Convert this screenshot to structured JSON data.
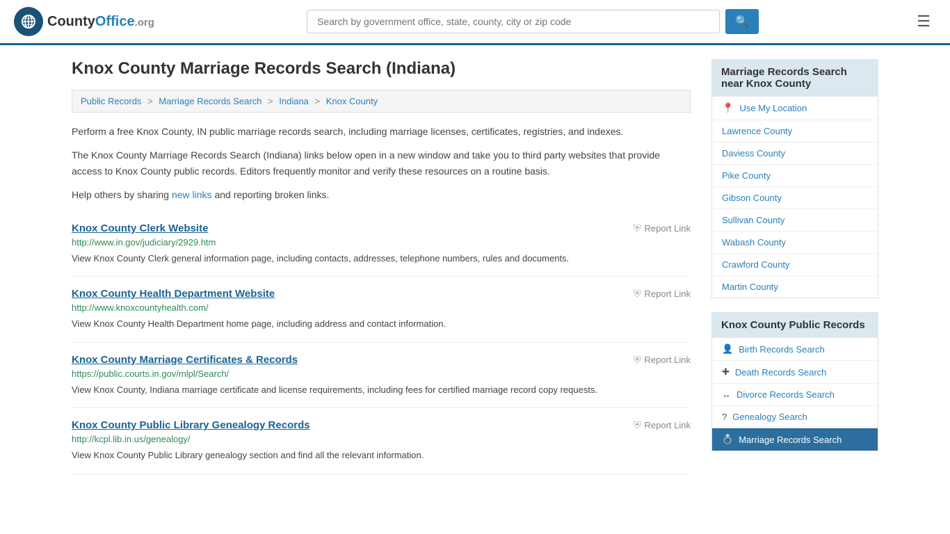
{
  "header": {
    "logo_text": "County",
    "logo_org": "Office.org",
    "search_placeholder": "Search by government office, state, county, city or zip code",
    "search_value": ""
  },
  "page": {
    "title": "Knox County Marriage Records Search (Indiana)",
    "breadcrumb": [
      {
        "label": "Public Records",
        "href": "#"
      },
      {
        "label": "Marriage Records Search",
        "href": "#"
      },
      {
        "label": "Indiana",
        "href": "#"
      },
      {
        "label": "Knox County",
        "href": "#"
      }
    ],
    "description1": "Perform a free Knox County, IN public marriage records search, including marriage licenses, certificates, registries, and indexes.",
    "description2": "The Knox County Marriage Records Search (Indiana) links below open in a new window and take you to third party websites that provide access to Knox County public records. Editors frequently monitor and verify these resources on a routine basis.",
    "description3_pre": "Help others by sharing ",
    "description3_link": "new links",
    "description3_post": " and reporting broken links.",
    "results": [
      {
        "title": "Knox County Clerk Website",
        "url": "http://www.in.gov/judiciary/2929.htm",
        "desc": "View Knox County Clerk general information page, including contacts, addresses, telephone numbers, rules and documents.",
        "report": "Report Link"
      },
      {
        "title": "Knox County Health Department Website",
        "url": "http://www.knoxcountyhealth.com/",
        "desc": "View Knox County Health Department home page, including address and contact information.",
        "report": "Report Link"
      },
      {
        "title": "Knox County Marriage Certificates & Records",
        "url": "https://public.courts.in.gov/mlpl/Search/",
        "desc": "View Knox County, Indiana marriage certificate and license requirements, including fees for certified marriage record copy requests.",
        "report": "Report Link"
      },
      {
        "title": "Knox County Public Library Genealogy Records",
        "url": "http://kcpl.lib.in.us/genealogy/",
        "desc": "View Knox County Public Library genealogy section and find all the relevant information.",
        "report": "Report Link"
      }
    ]
  },
  "sidebar": {
    "nearby_header": "Marriage Records Search near Knox County",
    "use_my_location": "Use My Location",
    "nearby_counties": [
      {
        "label": "Lawrence County"
      },
      {
        "label": "Daviess County"
      },
      {
        "label": "Pike County"
      },
      {
        "label": "Gibson County"
      },
      {
        "label": "Sullivan County"
      },
      {
        "label": "Wabash County"
      },
      {
        "label": "Crawford County"
      },
      {
        "label": "Martin County"
      }
    ],
    "public_records_header": "Knox County Public Records",
    "public_records_items": [
      {
        "label": "Birth Records Search",
        "icon": "person"
      },
      {
        "label": "Death Records Search",
        "icon": "cross"
      },
      {
        "label": "Divorce Records Search",
        "icon": "arrows"
      },
      {
        "label": "Genealogy Search",
        "icon": "question"
      },
      {
        "label": "Marriage Records Search",
        "icon": "rings",
        "active": true
      }
    ]
  }
}
